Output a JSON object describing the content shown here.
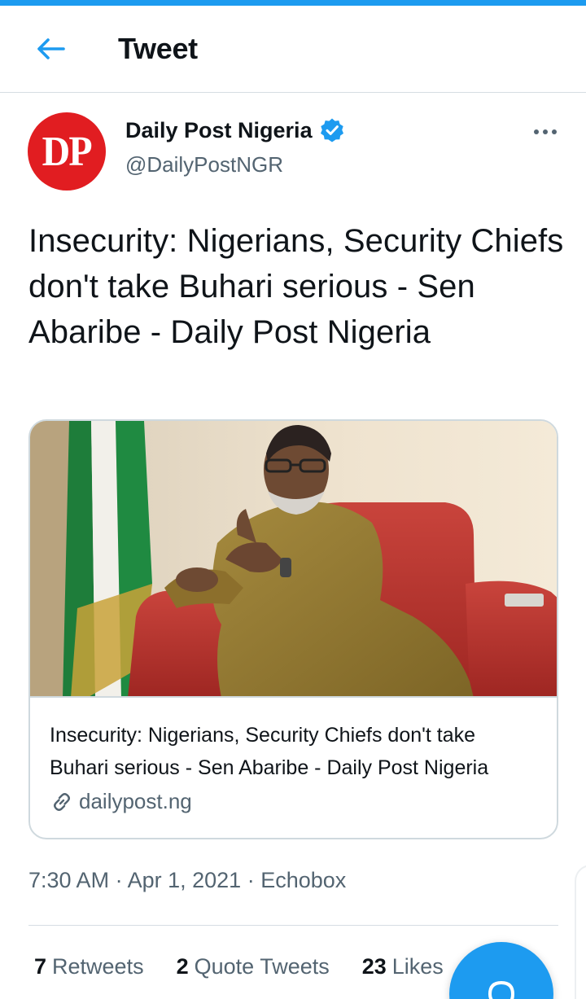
{
  "header": {
    "title": "Tweet",
    "back_icon": "arrow-left-icon"
  },
  "author": {
    "avatar_text": "DP",
    "display_name": "Daily Post Nigeria",
    "handle": "@DailyPostNGR",
    "verified": true
  },
  "tweet": {
    "text": "Insecurity: Nigerians, Security Chiefs don't take Buhari serious - Sen Abaribe - Daily Post Nigeria"
  },
  "card": {
    "title": "Insecurity: Nigerians, Security Chiefs don't take Buhari serious - Sen Abaribe - Daily Post Nigeria",
    "domain": "dailypost.ng"
  },
  "meta": {
    "time": "7:30 AM",
    "date": "Apr 1, 2021",
    "source": "Echobox",
    "separator": "·"
  },
  "stats": {
    "retweets_count": "7",
    "retweets_label": "Retweets",
    "quotes_count": "2",
    "quotes_label": "Quote Tweets",
    "likes_count": "23",
    "likes_label": "Likes"
  },
  "colors": {
    "accent": "#1d9bf0",
    "avatar_bg": "#e11d21",
    "secondary_text": "#536471"
  }
}
